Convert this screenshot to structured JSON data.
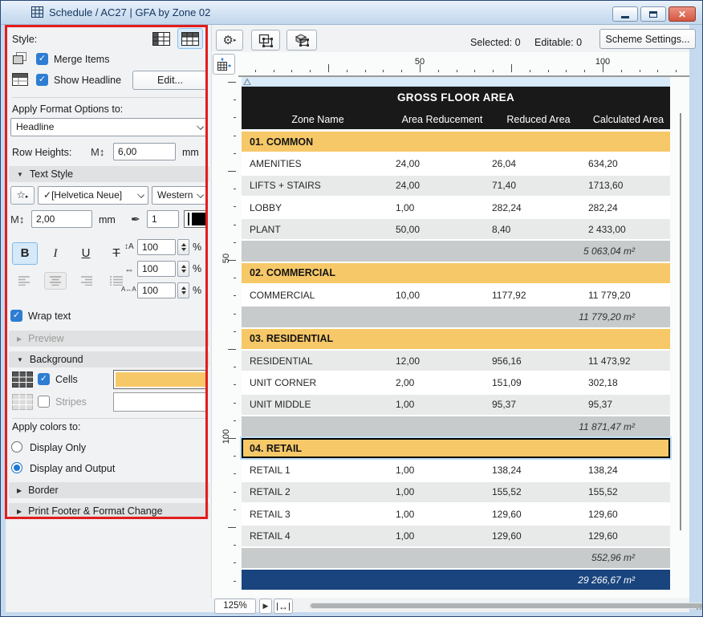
{
  "window": {
    "title": "Schedule / AC27 | GFA by Zone 02"
  },
  "toolbar": {
    "selected_text": "Selected: 0",
    "editable_text": "Editable: 0",
    "scheme_settings_button": "Scheme Settings..."
  },
  "panel": {
    "style_label": "Style:",
    "merge_items_label": "Merge Items",
    "show_headline_label": "Show Headline",
    "edit_button": "Edit...",
    "apply_format_label": "Apply Format Options to:",
    "format_target_value": "Headline",
    "row_heights_label": "Row Heights:",
    "row_height_value": "6,00",
    "row_height_unit": "mm",
    "text_style_header": "Text Style",
    "font_value": "[Helvetica Neue]",
    "script_value": "Western",
    "font_size_value": "2,00",
    "font_size_unit": "mm",
    "pen_value": "1",
    "bold_label": "B",
    "italic_label": "I",
    "underline_label": "U",
    "strike_label": "T",
    "line_spacing_value": "100",
    "char_width_value": "100",
    "tracking_value": "100",
    "percent": "%",
    "wrap_text_label": "Wrap text",
    "preview_header": "Preview",
    "background_header": "Background",
    "cells_label": "Cells",
    "stripes_label": "Stripes",
    "cells_color": "#f7c868",
    "stripes_color": "#ffffff",
    "apply_colors_label": "Apply colors to:",
    "radio_display_only": "Display Only",
    "radio_display_output": "Display and Output",
    "border_header": "Border",
    "print_footer_header": "Print Footer & Format Change"
  },
  "icons": {
    "check": "✓",
    "gear": "⚙",
    "star": "☆",
    "play": "▶",
    "tri_down": "▼",
    "tri_right": "▶",
    "row_height": "M↕",
    "pen": "✒",
    "line_spacing": "↕A",
    "char_width": "⇔",
    "tracking": "A↔A",
    "fit_width": "↔"
  },
  "schedule": {
    "title": "GROSS FLOOR AREA",
    "columns": [
      "Zone Name",
      "Area Reducement",
      "Reduced Area",
      "Calculated Area"
    ],
    "colors": {
      "section_bg": "#f7c868",
      "stripe_bg": "#e8eaea",
      "subtotal_bg": "#c7cbcb",
      "total_bg": "#19447e",
      "header_bg": "#191919"
    },
    "rows": [
      {
        "type": "section",
        "label": "01. COMMON"
      },
      {
        "type": "data",
        "stripe": false,
        "cells": [
          "AMENITIES",
          "24,00",
          "26,04",
          "634,20"
        ]
      },
      {
        "type": "data",
        "stripe": true,
        "cells": [
          "LIFTS + STAIRS",
          "24,00",
          "71,40",
          "1713,60"
        ]
      },
      {
        "type": "data",
        "stripe": false,
        "cells": [
          "LOBBY",
          "1,00",
          "282,24",
          "282,24"
        ]
      },
      {
        "type": "data",
        "stripe": true,
        "cells": [
          "PLANT",
          "50,00",
          "8,40",
          "2 433,00"
        ]
      },
      {
        "type": "subtotal",
        "value": "5 063,04 m²"
      },
      {
        "type": "section",
        "label": "02. COMMERCIAL"
      },
      {
        "type": "data",
        "stripe": false,
        "cells": [
          "COMMERCIAL",
          "10,00",
          "1177,92",
          "11 779,20"
        ]
      },
      {
        "type": "subtotal",
        "value": "11 779,20 m²"
      },
      {
        "type": "section",
        "label": "03. RESIDENTIAL"
      },
      {
        "type": "data",
        "stripe": true,
        "cells": [
          "RESIDENTIAL",
          "12,00",
          "956,16",
          "11 473,92"
        ]
      },
      {
        "type": "data",
        "stripe": false,
        "cells": [
          "UNIT CORNER",
          "2,00",
          "151,09",
          "302,18"
        ]
      },
      {
        "type": "data",
        "stripe": true,
        "cells": [
          "UNIT MIDDLE",
          "1,00",
          "95,37",
          "95,37"
        ]
      },
      {
        "type": "subtotal",
        "value": "11 871,47 m²"
      },
      {
        "type": "section",
        "label": "04. RETAIL",
        "selected": true
      },
      {
        "type": "data",
        "stripe": false,
        "cells": [
          "RETAIL 1",
          "1,00",
          "138,24",
          "138,24"
        ]
      },
      {
        "type": "data",
        "stripe": true,
        "cells": [
          "RETAIL 2",
          "1,00",
          "155,52",
          "155,52"
        ]
      },
      {
        "type": "data",
        "stripe": false,
        "cells": [
          "RETAIL 3",
          "1,00",
          "129,60",
          "129,60"
        ]
      },
      {
        "type": "data",
        "stripe": true,
        "cells": [
          "RETAIL 4",
          "1,00",
          "129,60",
          "129,60"
        ]
      },
      {
        "type": "subtotal",
        "value": "552,96 m²"
      },
      {
        "type": "total",
        "value": "29 266,67 m²"
      }
    ]
  },
  "rulers": {
    "h_labels": [
      {
        "text": "50",
        "pos": 226
      },
      {
        "text": "100",
        "pos": 454
      }
    ],
    "v_labels": [
      {
        "text": "50",
        "pos": 228
      },
      {
        "text": "100",
        "pos": 450
      }
    ]
  },
  "statusbar": {
    "zoom_value": "125%"
  }
}
